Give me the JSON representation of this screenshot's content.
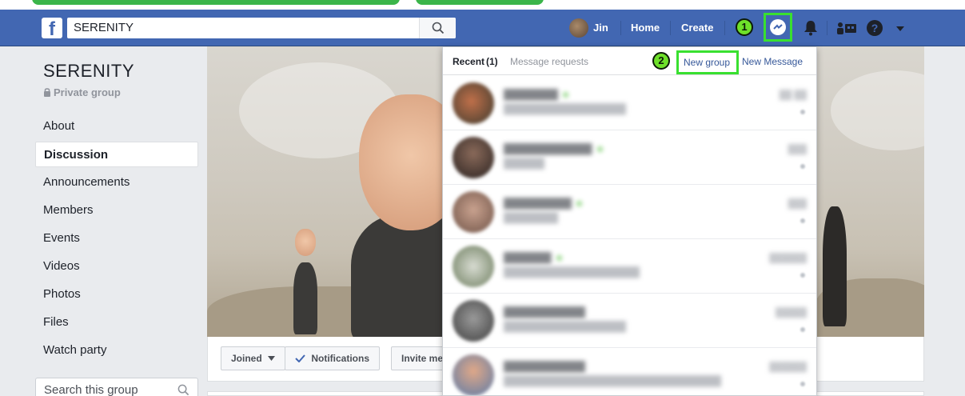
{
  "nav": {
    "search_value": "SERENITY",
    "user_name": "Jin",
    "home": "Home",
    "create": "Create",
    "step1": "1"
  },
  "sidebar": {
    "title": "SERENITY",
    "privacy": "Private group",
    "items": [
      {
        "label": "About",
        "active": false
      },
      {
        "label": "Discussion",
        "active": true
      },
      {
        "label": "Announcements",
        "active": false
      },
      {
        "label": "Members",
        "active": false
      },
      {
        "label": "Events",
        "active": false
      },
      {
        "label": "Videos",
        "active": false
      },
      {
        "label": "Photos",
        "active": false
      },
      {
        "label": "Files",
        "active": false
      },
      {
        "label": "Watch party",
        "active": false
      }
    ],
    "search_placeholder": "Search this group"
  },
  "actions": {
    "joined": "Joined",
    "notifications": "Notifications",
    "invite": "Invite me"
  },
  "messenger": {
    "recent_label": "Recent",
    "recent_count": "(1)",
    "requests": "Message requests",
    "step2": "2",
    "new_group": "New group",
    "new_message": "New Message"
  },
  "colors": {
    "brand": "#4267b2",
    "highlight": "#39e030",
    "link": "#365899"
  }
}
